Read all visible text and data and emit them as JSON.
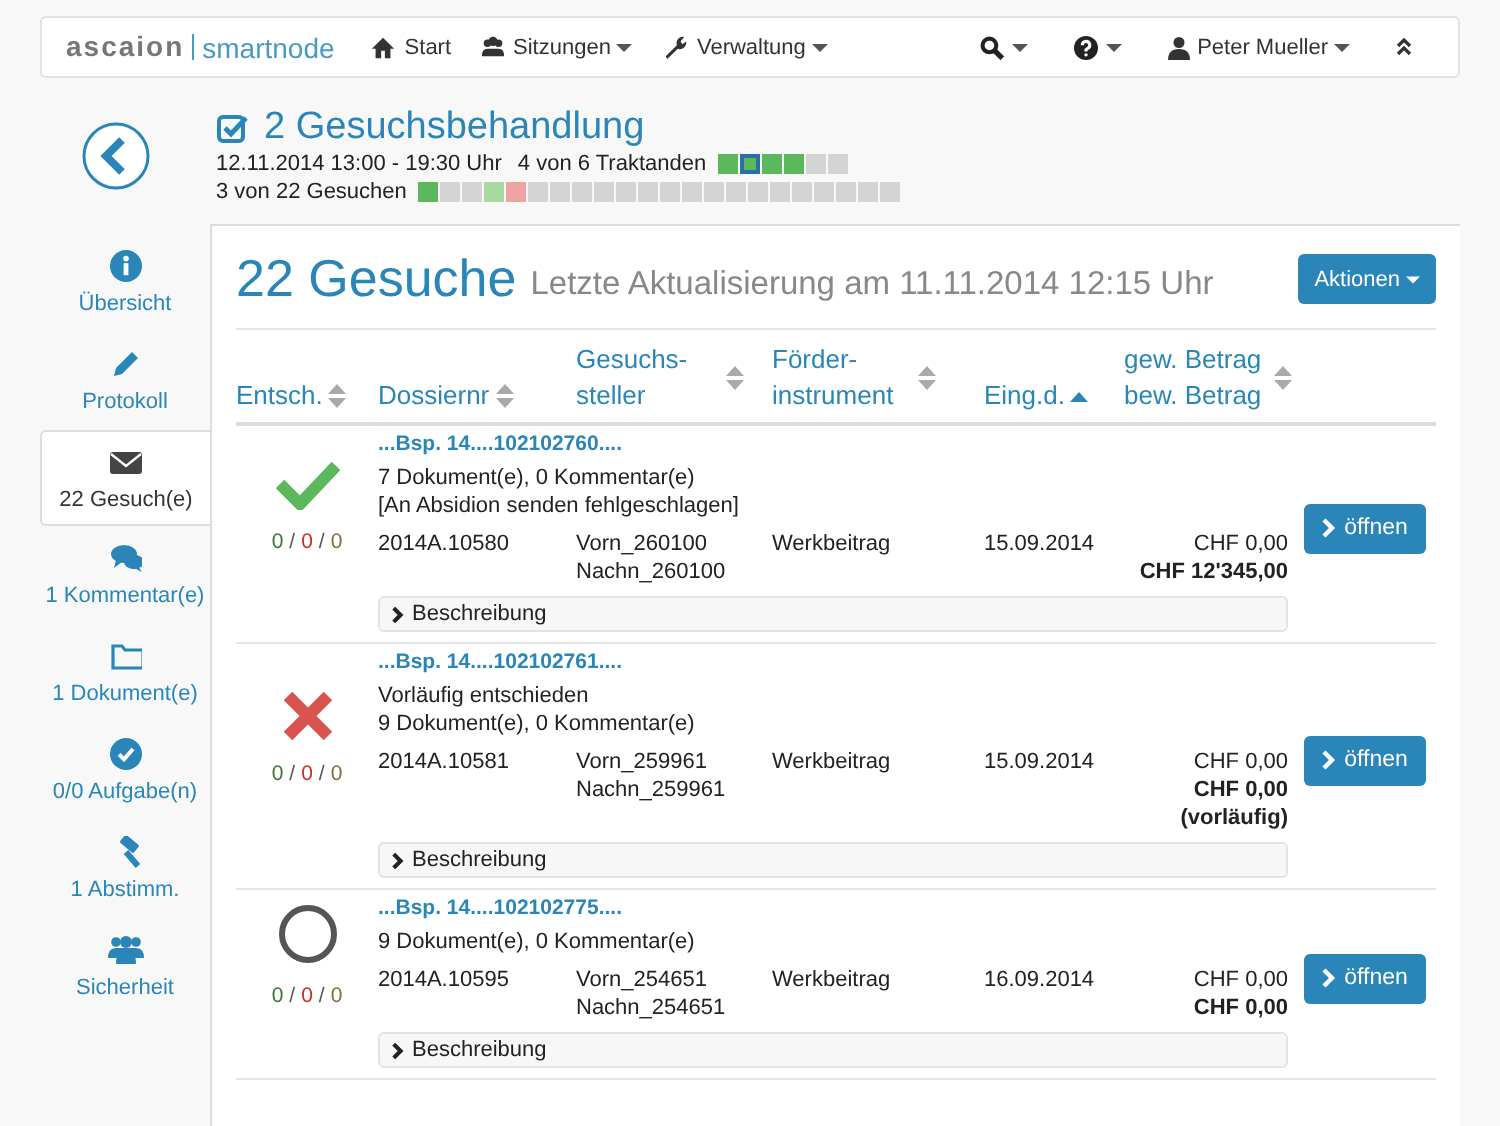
{
  "navbar": {
    "brand": "ascaion",
    "product": "smartnode",
    "menu": [
      {
        "label": "Start",
        "dropdown": false
      },
      {
        "label": "Sitzungen",
        "dropdown": true
      },
      {
        "label": "Verwaltung",
        "dropdown": true
      }
    ],
    "user": "Peter Mueller"
  },
  "header": {
    "title": "2 Gesuchsbehandlung",
    "time": "12.11.2014 13:00 - 19:30 Uhr",
    "agenda_progress": "4 von 6 Traktanden",
    "agenda_steps": [
      {
        "kind": "done",
        "selected": false
      },
      {
        "kind": "done",
        "selected": true
      },
      {
        "kind": "done",
        "selected": false
      },
      {
        "kind": "done",
        "selected": false
      },
      {
        "kind": "open",
        "selected": false
      },
      {
        "kind": "open",
        "selected": false
      }
    ],
    "request_progress": "3 von 22 Gesuchen",
    "request_steps": [
      {
        "kind": "done"
      },
      {
        "kind": "open"
      },
      {
        "kind": "open"
      },
      {
        "kind": "partial"
      },
      {
        "kind": "rejected"
      },
      {
        "kind": "open"
      },
      {
        "kind": "open"
      },
      {
        "kind": "open"
      },
      {
        "kind": "open"
      },
      {
        "kind": "open"
      },
      {
        "kind": "open"
      },
      {
        "kind": "open"
      },
      {
        "kind": "open"
      },
      {
        "kind": "open"
      },
      {
        "kind": "open"
      },
      {
        "kind": "open"
      },
      {
        "kind": "open"
      },
      {
        "kind": "open"
      },
      {
        "kind": "open"
      },
      {
        "kind": "open"
      },
      {
        "kind": "open"
      },
      {
        "kind": "open"
      }
    ]
  },
  "sidebar": {
    "items": [
      {
        "label": "Übersicht",
        "selected": false
      },
      {
        "label": "Protokoll",
        "selected": false
      },
      {
        "label": "22 Gesuch(e)",
        "selected": true
      },
      {
        "label": "1 Kommentar(e)",
        "selected": false
      },
      {
        "label": "1 Dokument(e)",
        "selected": false
      },
      {
        "label": "0/0 Aufgabe(n)",
        "selected": false
      },
      {
        "label": "1 Abstimm.",
        "selected": false
      },
      {
        "label": "Sicherheit",
        "selected": false
      }
    ]
  },
  "panel": {
    "title": "22 Gesuche",
    "subtitle": "Letzte Aktualisierung am 11.11.2014 12:15 Uhr",
    "actions_button": "Aktionen",
    "columns": [
      {
        "label": "Entsch.",
        "sorted": false
      },
      {
        "label": "Dossiernr",
        "sorted": false
      },
      {
        "label": "Gesuchs- steller",
        "sorted": false
      },
      {
        "label": "Förder- instrument",
        "sorted": false
      },
      {
        "label": "Eing.d.",
        "sorted": true
      },
      {
        "label": "gew. Betrag bew. Betrag",
        "sorted": false
      }
    ],
    "rows": [
      {
        "kind": "approved",
        "counts": [
          {
            "kind": "green",
            "text": "0"
          },
          {
            "kind": "separator",
            "text": "/"
          },
          {
            "kind": "red",
            "text": "0"
          },
          {
            "kind": "separator",
            "text": "/"
          },
          {
            "kind": "olive",
            "text": "0"
          }
        ],
        "title": "...Bsp. 14....102102760....",
        "notes": [
          "7 Dokument(e), 0 Kommentar(e)",
          "[An Absidion senden fehlgeschlagen]"
        ],
        "dossier": "2014A.10580",
        "applicant": [
          "Vorn_260100",
          "Nachn_260100"
        ],
        "instrument": "Werkbeitrag",
        "date": "15.09.2014",
        "amounts": [
          {
            "text": "CHF 0,00",
            "bold": false
          },
          {
            "text": "CHF 12'345,00",
            "bold": true
          }
        ],
        "open_button": "öffnen",
        "description": "Beschreibung"
      },
      {
        "kind": "rejected",
        "counts": [
          {
            "kind": "green",
            "text": "0"
          },
          {
            "kind": "separator",
            "text": "/"
          },
          {
            "kind": "red",
            "text": "0"
          },
          {
            "kind": "separator",
            "text": "/"
          },
          {
            "kind": "olive",
            "text": "0"
          }
        ],
        "title": "...Bsp. 14....102102761....",
        "notes": [
          "Vorläufig entschieden",
          "9 Dokument(e), 0 Kommentar(e)"
        ],
        "dossier": "2014A.10581",
        "applicant": [
          "Vorn_259961",
          "Nachn_259961"
        ],
        "instrument": "Werkbeitrag",
        "date": "15.09.2014",
        "amounts": [
          {
            "text": "CHF 0,00",
            "bold": false
          },
          {
            "text": "CHF 0,00",
            "bold": true
          },
          {
            "text": "(vorläufig)",
            "bold": true
          }
        ],
        "open_button": "öffnen",
        "description": "Beschreibung"
      },
      {
        "kind": "open",
        "counts": [
          {
            "kind": "green",
            "text": "0"
          },
          {
            "kind": "separator",
            "text": "/"
          },
          {
            "kind": "red",
            "text": "0"
          },
          {
            "kind": "separator",
            "text": "/"
          },
          {
            "kind": "olive",
            "text": "0"
          }
        ],
        "title": "...Bsp. 14....102102775....",
        "notes": [
          "9 Dokument(e), 0 Kommentar(e)"
        ],
        "dossier": "2014A.10595",
        "applicant": [
          "Vorn_254651",
          "Nachn_254651"
        ],
        "instrument": "Werkbeitrag",
        "date": "16.09.2014",
        "amounts": [
          {
            "text": "CHF 0,00",
            "bold": false
          },
          {
            "text": "CHF 0,00",
            "bold": true
          }
        ],
        "open_button": "öffnen",
        "description": "Beschreibung"
      }
    ]
  }
}
